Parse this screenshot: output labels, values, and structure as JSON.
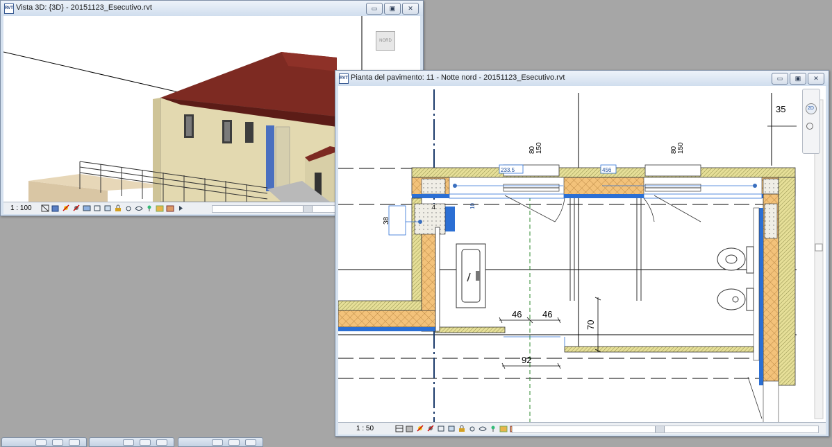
{
  "window_3d": {
    "title": "Vista 3D: {3D} - 20151123_Esecutivo.rvt",
    "scale": "1 : 100",
    "viewcube_label": "NORD"
  },
  "window_plan": {
    "title": "Pianta del pavimento: 11 - Notte nord - 20151123_Esecutivo.rvt",
    "scale": "1 : 50",
    "dimensions": {
      "d35": "35",
      "d80a": "80",
      "d150a": "150",
      "d80b": "80",
      "d150b": "150",
      "d233": "233.5",
      "d456": "456",
      "d10": "10",
      "d38": "38",
      "d4": "4",
      "d46a": "46",
      "d46b": "46",
      "d70": "70",
      "d92": "92",
      "nav_2d": "2D"
    }
  },
  "window_controls": {
    "minimize": "▭",
    "restore": "▣",
    "close": "✕"
  }
}
